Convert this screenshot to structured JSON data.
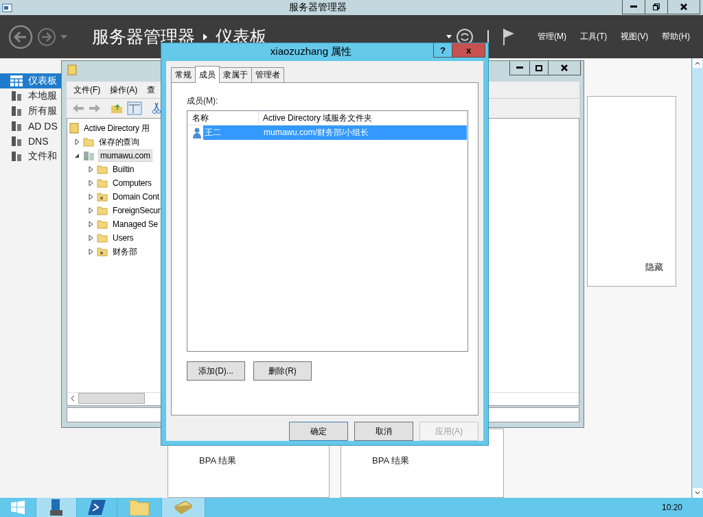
{
  "server_manager": {
    "title": "服务器管理器",
    "breadcrumb_root": "服务器管理器",
    "breadcrumb_page": "仪表板",
    "menu": [
      "管理(M)",
      "工具(T)",
      "视图(V)",
      "帮助(H)"
    ],
    "sidebar": [
      {
        "label": "仪表板",
        "selected": true
      },
      {
        "label": "本地服",
        "selected": false
      },
      {
        "label": "所有服",
        "selected": false
      },
      {
        "label": "AD DS",
        "selected": false
      },
      {
        "label": "DNS",
        "selected": false
      },
      {
        "label": "文件和",
        "selected": false
      }
    ],
    "hide_label": "隐藏",
    "tiles": [
      {
        "label": "BPA 结果"
      },
      {
        "label": "BPA 结果"
      }
    ]
  },
  "ad_window": {
    "menu": [
      "文件(F)",
      "操作(A)",
      "查"
    ],
    "tree": [
      {
        "label": "Active Directory 用",
        "kind": "snapin",
        "children": [
          {
            "label": "保存的查询",
            "kind": "folder",
            "expanded": false,
            "selected": false
          },
          {
            "label": "mumawu.com",
            "kind": "domain",
            "expanded": true,
            "selected": true,
            "children": [
              {
                "label": "Builtin",
                "kind": "folder",
                "expanded": false,
                "selected": false
              },
              {
                "label": "Computers",
                "kind": "folder",
                "expanded": false,
                "selected": false
              },
              {
                "label": "Domain Cont",
                "kind": "ou",
                "expanded": false,
                "selected": false
              },
              {
                "label": "ForeignSecur",
                "kind": "folder",
                "expanded": false,
                "selected": false
              },
              {
                "label": "Managed Se",
                "kind": "folder",
                "expanded": false,
                "selected": false
              },
              {
                "label": "Users",
                "kind": "folder",
                "expanded": false,
                "selected": false
              },
              {
                "label": "财务部",
                "kind": "ou",
                "expanded": false,
                "selected": false
              }
            ]
          }
        ]
      }
    ]
  },
  "dialog": {
    "title": "xiaozuzhang 属性",
    "help": "?",
    "close": "x",
    "tabs": [
      {
        "label": "常规",
        "selected": false
      },
      {
        "label": "成员",
        "selected": true
      },
      {
        "label": "隶属于",
        "selected": false
      },
      {
        "label": "管理者",
        "selected": false
      }
    ],
    "members_label": "成员(M):",
    "columns": [
      "名称",
      "Active Directory 域服务文件夹"
    ],
    "rows": [
      {
        "name": "王二",
        "folder": "mumawu.com/财务部/小组长",
        "selected": true
      }
    ],
    "list_buttons": [
      {
        "label": "添加(D)...",
        "disabled": false
      },
      {
        "label": "删除(R)",
        "disabled": false
      }
    ],
    "footer_buttons": [
      {
        "label": "确定",
        "default": true,
        "disabled": false
      },
      {
        "label": "取消",
        "default": false,
        "disabled": false
      },
      {
        "label": "应用(A)",
        "default": false,
        "disabled": true
      }
    ]
  },
  "taskbar": {
    "clock": "10:20"
  }
}
